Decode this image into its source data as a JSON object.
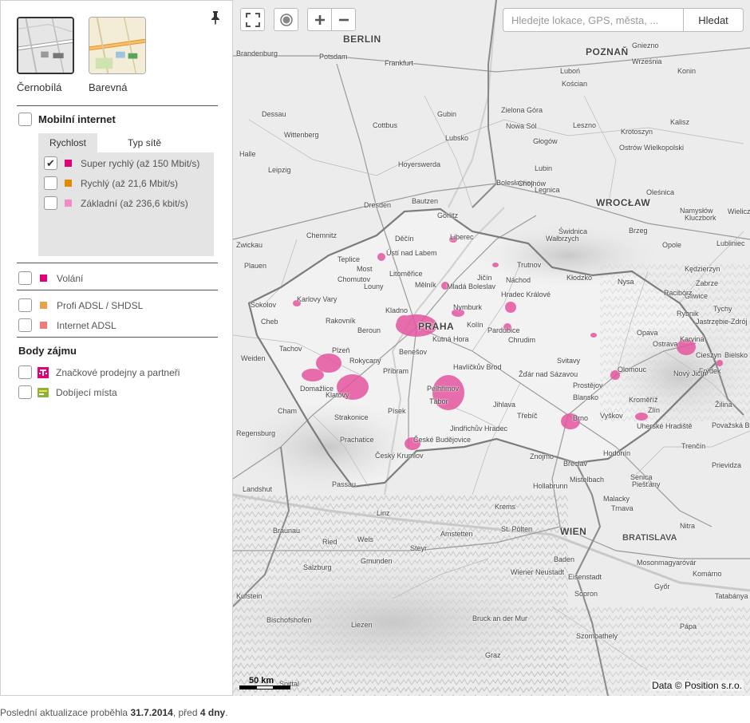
{
  "panel": {
    "map_styles": [
      {
        "label": "Černobílá",
        "active": true
      },
      {
        "label": "Barevná",
        "active": false
      }
    ],
    "mobile_internet": {
      "title": "Mobilní internet",
      "checked": false,
      "tabs": [
        {
          "label": "Rychlost",
          "active": true
        },
        {
          "label": "Typ sítě",
          "active": false
        }
      ],
      "speeds": [
        {
          "label": "Super rychlý (až 150 Mbit/s)",
          "color": "#e20074",
          "checked": true
        },
        {
          "label": "Rychlý (až 21,6 Mbit/s)",
          "color": "#e28a00",
          "checked": false
        },
        {
          "label": "Základní (až 236,6 kbit/s)",
          "color": "#f28cc4",
          "checked": false
        }
      ]
    },
    "calls": {
      "label": "Volání",
      "color": "#e20074",
      "checked": false
    },
    "adsl": [
      {
        "label": "Profi ADSL / SHDSL",
        "color": "#e8a24a",
        "checked": false
      },
      {
        "label": "Internet ADSL",
        "color": "#f07a7a",
        "checked": false
      }
    ],
    "poi": {
      "title": "Body zájmu",
      "items": [
        {
          "label": "Značkové prodejny a partneři",
          "icon": "t-logo-icon",
          "checked": false
        },
        {
          "label": "Dobíjecí místa",
          "icon": "topup-icon",
          "checked": false
        }
      ]
    }
  },
  "map": {
    "search_placeholder": "Hledejte lokace, GPS, města, ...",
    "search_button": "Hledat",
    "scale_label": "50 km",
    "attribution": "Data © Position s.r.o.",
    "accent_color": "#e20074",
    "labels": [
      {
        "name": "BERLIN",
        "cls": "big"
      },
      {
        "name": "POZNAŇ",
        "cls": "big"
      },
      {
        "name": "WROCŁAW",
        "cls": "big"
      },
      {
        "name": "PRAHA",
        "cls": "big"
      },
      {
        "name": "WIEN",
        "cls": "big"
      },
      {
        "name": "BRATISLAVA",
        "cls": "mid"
      },
      {
        "name": "Potsdam",
        "cls": "small"
      },
      {
        "name": "Frankfurt",
        "cls": "small"
      },
      {
        "name": "Cottbus",
        "cls": "small"
      },
      {
        "name": "Dresden",
        "cls": "small"
      },
      {
        "name": "Leipzig",
        "cls": "small"
      },
      {
        "name": "Chemnitz",
        "cls": "small"
      },
      {
        "name": "Zwickau",
        "cls": "small"
      },
      {
        "name": "Plauen",
        "cls": "small"
      },
      {
        "name": "Halle",
        "cls": "small"
      },
      {
        "name": "Dessau",
        "cls": "small"
      },
      {
        "name": "Zielona Góra",
        "cls": "small"
      },
      {
        "name": "Legnica",
        "cls": "small"
      },
      {
        "name": "Wałbrzych",
        "cls": "small"
      },
      {
        "name": "Opole",
        "cls": "small"
      },
      {
        "name": "Kalisz",
        "cls": "small"
      },
      {
        "name": "Liberec",
        "cls": "small"
      },
      {
        "name": "Ústí nad Labem",
        "cls": "small"
      },
      {
        "name": "Děčín",
        "cls": "small"
      },
      {
        "name": "Teplice",
        "cls": "small"
      },
      {
        "name": "Chomutov",
        "cls": "small"
      },
      {
        "name": "Most",
        "cls": "small"
      },
      {
        "name": "Karlovy Vary",
        "cls": "small"
      },
      {
        "name": "Sokolov",
        "cls": "small"
      },
      {
        "name": "Cheb",
        "cls": "small"
      },
      {
        "name": "Kladno",
        "cls": "small"
      },
      {
        "name": "Mladá Boleslav",
        "cls": "small"
      },
      {
        "name": "Hradec Králové",
        "cls": "small"
      },
      {
        "name": "Pardubice",
        "cls": "small"
      },
      {
        "name": "Kolín",
        "cls": "small"
      },
      {
        "name": "Kutná Hora",
        "cls": "small"
      },
      {
        "name": "Benešov",
        "cls": "small"
      },
      {
        "name": "Plzeň",
        "cls": "small"
      },
      {
        "name": "Rokycany",
        "cls": "small"
      },
      {
        "name": "Příbram",
        "cls": "small"
      },
      {
        "name": "Klatovy",
        "cls": "small"
      },
      {
        "name": "Domažlice",
        "cls": "small"
      },
      {
        "name": "Strakonice",
        "cls": "small"
      },
      {
        "name": "Písek",
        "cls": "small"
      },
      {
        "name": "Tábor",
        "cls": "small"
      },
      {
        "name": "Pelhřimov",
        "cls": "small"
      },
      {
        "name": "Jihlava",
        "cls": "small"
      },
      {
        "name": "Havlíčkův Brod",
        "cls": "small"
      },
      {
        "name": "České Budějovice",
        "cls": "small"
      },
      {
        "name": "Český Krumlov",
        "cls": "small"
      },
      {
        "name": "Jindřichův Hradec",
        "cls": "small"
      },
      {
        "name": "Třebíč",
        "cls": "small"
      },
      {
        "name": "Brno",
        "cls": "small"
      },
      {
        "name": "Znojmo",
        "cls": "small"
      },
      {
        "name": "Břeclav",
        "cls": "small"
      },
      {
        "name": "Olomouc",
        "cls": "small"
      },
      {
        "name": "Prostějov",
        "cls": "small"
      },
      {
        "name": "Zlín",
        "cls": "small"
      },
      {
        "name": "Kroměříž",
        "cls": "small"
      },
      {
        "name": "Uherské Hradiště",
        "cls": "small"
      },
      {
        "name": "Ostrava",
        "cls": "small"
      },
      {
        "name": "Opava",
        "cls": "small"
      },
      {
        "name": "Karviná",
        "cls": "small"
      },
      {
        "name": "Frýdek",
        "cls": "small"
      },
      {
        "name": "Nový Jičín",
        "cls": "small"
      },
      {
        "name": "Svitavy",
        "cls": "small"
      },
      {
        "name": "Chrudim",
        "cls": "small"
      },
      {
        "name": "Jičín",
        "cls": "small"
      },
      {
        "name": "Trutnov",
        "cls": "small"
      },
      {
        "name": "Náchod",
        "cls": "small"
      },
      {
        "name": "Žďár nad Sázavou",
        "cls": "small"
      },
      {
        "name": "Blansko",
        "cls": "small"
      },
      {
        "name": "Vyškov",
        "cls": "small"
      },
      {
        "name": "Hodonín",
        "cls": "small"
      },
      {
        "name": "Regensburg",
        "cls": "small"
      },
      {
        "name": "Passau",
        "cls": "small"
      },
      {
        "name": "Landshut",
        "cls": "small"
      },
      {
        "name": "Linz",
        "cls": "small"
      },
      {
        "name": "Wels",
        "cls": "small"
      },
      {
        "name": "Steyr",
        "cls": "small"
      },
      {
        "name": "St. Pölten",
        "cls": "small"
      },
      {
        "name": "Krems",
        "cls": "small"
      },
      {
        "name": "Salzburg",
        "cls": "small"
      },
      {
        "name": "Gmunden",
        "cls": "small"
      },
      {
        "name": "Wiener Neustadt",
        "cls": "small"
      },
      {
        "name": "Sopron",
        "cls": "small"
      },
      {
        "name": "Győr",
        "cls": "small"
      },
      {
        "name": "Trnava",
        "cls": "small"
      },
      {
        "name": "Nitra",
        "cls": "small"
      },
      {
        "name": "Trenčín",
        "cls": "small"
      },
      {
        "name": "Žilina",
        "cls": "small"
      },
      {
        "name": "Senica",
        "cls": "small"
      },
      {
        "name": "Malacky",
        "cls": "small"
      },
      {
        "name": "Komárno",
        "cls": "small"
      },
      {
        "name": "Tatabánya",
        "cls": "small"
      },
      {
        "name": "Szombathely",
        "cls": "small"
      },
      {
        "name": "Graz",
        "cls": "small"
      },
      {
        "name": "Bruck an der Mur",
        "cls": "small"
      },
      {
        "name": "Liezen",
        "cls": "small"
      },
      {
        "name": "Bischofshofen",
        "cls": "small"
      },
      {
        "name": "Rybnik",
        "cls": "small"
      },
      {
        "name": "Gliwice",
        "cls": "small"
      },
      {
        "name": "Zabrze",
        "cls": "small"
      },
      {
        "name": "Tychy",
        "cls": "small"
      },
      {
        "name": "Jastrzębie-Zdrój",
        "cls": "small"
      },
      {
        "name": "Kłodzko",
        "cls": "small"
      },
      {
        "name": "Nysa",
        "cls": "small"
      },
      {
        "name": "Brzeg",
        "cls": "small"
      },
      {
        "name": "Świdnica",
        "cls": "small"
      },
      {
        "name": "Lubin",
        "cls": "small"
      },
      {
        "name": "Głogów",
        "cls": "small"
      },
      {
        "name": "Nowa Sól",
        "cls": "small"
      },
      {
        "name": "Bautzen",
        "cls": "small"
      },
      {
        "name": "Görlitz",
        "cls": "small"
      },
      {
        "name": "Hoyerswerda",
        "cls": "small"
      },
      {
        "name": "Gubin",
        "cls": "small"
      },
      {
        "name": "Lubsko",
        "cls": "small"
      },
      {
        "name": "Bolesławiec",
        "cls": "small"
      },
      {
        "name": "Wittenberg",
        "cls": "small"
      },
      {
        "name": "Brandenburg",
        "cls": "small"
      },
      {
        "name": "Chojnów",
        "cls": "small"
      },
      {
        "name": "Oleśnica",
        "cls": "small"
      },
      {
        "name": "Krotoszyn",
        "cls": "small"
      },
      {
        "name": "Ostrów Wielkopolski",
        "cls": "small"
      },
      {
        "name": "Leszno",
        "cls": "small"
      },
      {
        "name": "Kościan",
        "cls": "small"
      },
      {
        "name": "Luboń",
        "cls": "small"
      },
      {
        "name": "Gniezno",
        "cls": "small"
      },
      {
        "name": "Września",
        "cls": "small"
      },
      {
        "name": "Konin",
        "cls": "small"
      },
      {
        "name": "Kluczbork",
        "cls": "small"
      },
      {
        "name": "Lubliniec",
        "cls": "small"
      },
      {
        "name": "Namysłów",
        "cls": "small"
      },
      {
        "name": "Kędzierzyn",
        "cls": "small"
      },
      {
        "name": "Racibórz",
        "cls": "small"
      },
      {
        "name": "Weiden",
        "cls": "small"
      },
      {
        "name": "Cham",
        "cls": "small"
      },
      {
        "name": "Tachov",
        "cls": "small"
      },
      {
        "name": "Rakovník",
        "cls": "small"
      },
      {
        "name": "Beroun",
        "cls": "small"
      },
      {
        "name": "Louny",
        "cls": "small"
      },
      {
        "name": "Litoměřice",
        "cls": "small"
      },
      {
        "name": "Mělník",
        "cls": "small"
      },
      {
        "name": "Nymburk",
        "cls": "small"
      },
      {
        "name": "Prachatice",
        "cls": "small"
      },
      {
        "name": "Hollabrunn",
        "cls": "small"
      },
      {
        "name": "Mistelbach",
        "cls": "small"
      },
      {
        "name": "Piešťany",
        "cls": "small"
      },
      {
        "name": "Prievidza",
        "cls": "small"
      },
      {
        "name": "Považská Bystrica",
        "cls": "small"
      },
      {
        "name": "Cieszyn",
        "cls": "small"
      },
      {
        "name": "Bielsko",
        "cls": "small"
      },
      {
        "name": "Wieliczka",
        "cls": "small"
      },
      {
        "name": "Braunau",
        "cls": "small"
      },
      {
        "name": "Ried",
        "cls": "small"
      },
      {
        "name": "Amstetten",
        "cls": "small"
      },
      {
        "name": "Baden",
        "cls": "small"
      },
      {
        "name": "Eisenstadt",
        "cls": "small"
      },
      {
        "name": "Mosonmagyaróvár",
        "cls": "small"
      },
      {
        "name": "Pápa",
        "cls": "small"
      },
      {
        "name": "Kufstein",
        "cls": "small"
      },
      {
        "name": "Spittal",
        "cls": "small"
      }
    ]
  },
  "footer": {
    "prefix": "Poslední aktualizace proběhla ",
    "date": "31.7.2014",
    "middle": ", před ",
    "days": "4 dny",
    "suffix": "."
  }
}
